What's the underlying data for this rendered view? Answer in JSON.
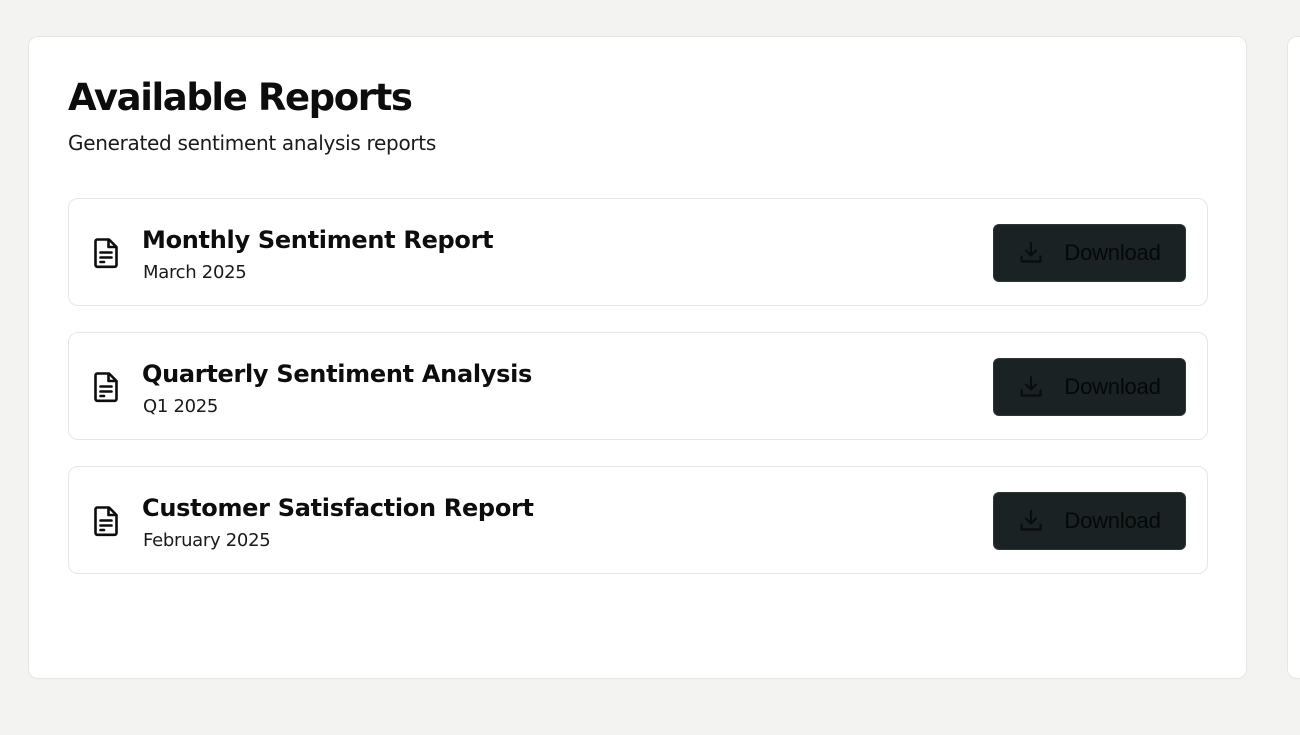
{
  "panel": {
    "title": "Available Reports",
    "subtitle": "Generated sentiment analysis reports"
  },
  "reports": [
    {
      "name": "Monthly Sentiment Report",
      "date": "March 2025",
      "icon": "document-icon",
      "button_label": "Download",
      "button_icon": "download-icon"
    },
    {
      "name": "Quarterly Sentiment Analysis",
      "date": "Q1 2025",
      "icon": "document-icon",
      "button_label": "Download",
      "button_icon": "download-icon"
    },
    {
      "name": "Customer Satisfaction Report",
      "date": "February 2025",
      "icon": "document-icon",
      "button_label": "Download",
      "button_icon": "download-icon"
    }
  ],
  "colors": {
    "background": "#f3f3f2",
    "card": "#ffffff",
    "border": "#e6e6e4",
    "button": "#1b2223",
    "button_text": "#050807"
  }
}
